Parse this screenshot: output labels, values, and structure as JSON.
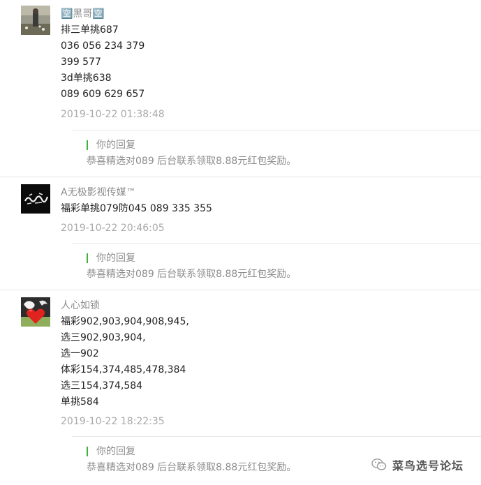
{
  "comments": [
    {
      "nickname": "🈳黑哥🈳",
      "lines": [
        "排三单挑687",
        "036 056 234 379",
        "399 577",
        "3d单挑638",
        "089 609 629 657"
      ],
      "time": "2019-10-22 01:38:48",
      "reply_label": "你的回复",
      "reply_text": "恭喜精选对089  后台联系领取8.88元红包奖励。"
    },
    {
      "nickname": "A无极影视传媒™",
      "lines": [
        "福彩单挑079防045 089 335 355"
      ],
      "time": "2019-10-22 20:46:05",
      "reply_label": "你的回复",
      "reply_text": "恭喜精选对089  后台联系领取8.88元红包奖励。"
    },
    {
      "nickname": "人心如锁",
      "lines": [
        "福彩902,903,904,908,945,",
        "选三902,903,904,",
        "选一902",
        "体彩154,374,485,478,384",
        "选三154,374,584",
        "单挑584"
      ],
      "time": "2019-10-22 18:22:35",
      "reply_label": "你的回复",
      "reply_text": "恭喜精选对089  后台联系领取8.88元红包奖励。"
    }
  ],
  "watermark": {
    "text": "菜鸟选号论坛",
    "icon": "wechat-icon"
  },
  "colors": {
    "reply_bar": "#3fb23c",
    "meta_text": "#8c8c8c",
    "divider": "#e6e6e6"
  }
}
